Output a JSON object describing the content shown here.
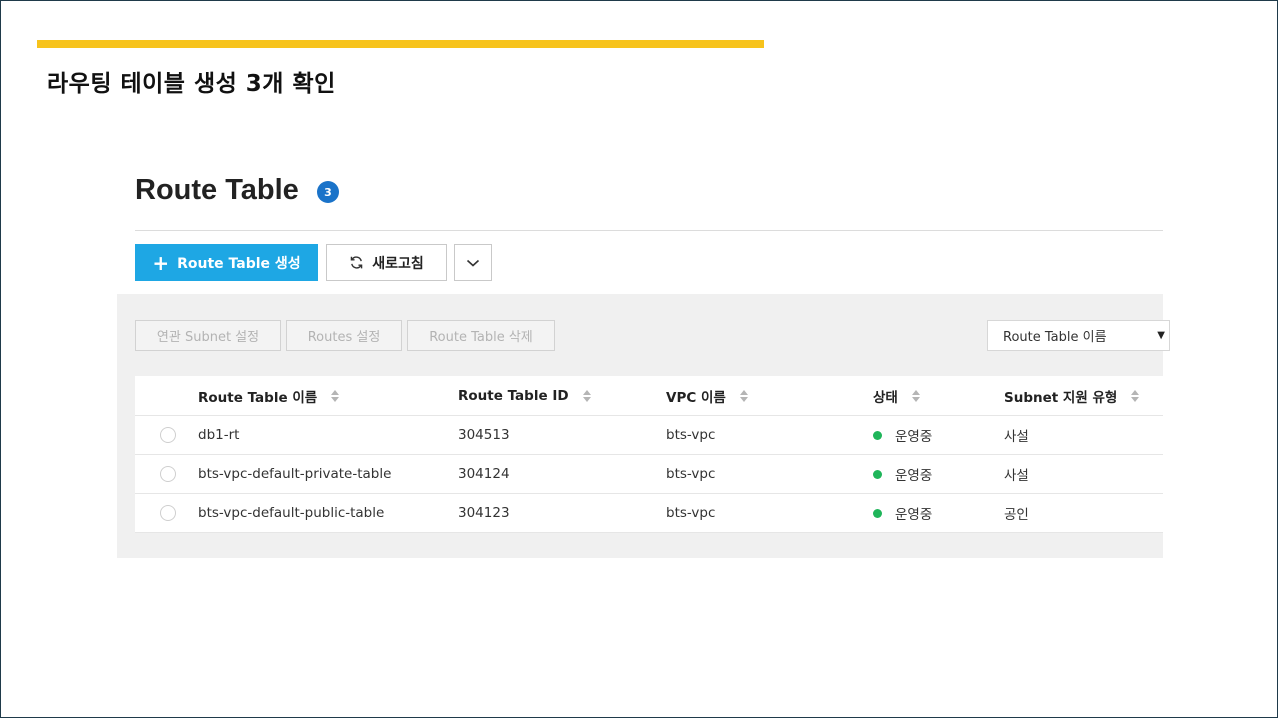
{
  "slide": {
    "title": "라우팅 테이블 생성 3개 확인",
    "accent_color": "#f7c31c"
  },
  "page": {
    "title": "Route Table",
    "count": "3"
  },
  "toolbar": {
    "create_label": "Route Table 생성",
    "refresh_label": "새로고침",
    "more_icon": "chevron-down-icon"
  },
  "actions": {
    "subnet_label": "연관 Subnet 설정",
    "routes_label": "Routes 설정",
    "delete_label": "Route Table 삭제"
  },
  "filter": {
    "selected": "Route Table 이름"
  },
  "table": {
    "columns": [
      "Route Table 이름",
      "Route Table ID",
      "VPC 이름",
      "상태",
      "Subnet 지원 유형"
    ],
    "rows": [
      [
        "db1-rt",
        "304513",
        "bts-vpc",
        "운영중",
        "사설"
      ],
      [
        "bts-vpc-default-private-table",
        "304124",
        "bts-vpc",
        "운영중",
        "사설"
      ],
      [
        "bts-vpc-default-public-table",
        "304123",
        "bts-vpc",
        "운영중",
        "공인"
      ]
    ],
    "status_color": "#1fb55a"
  },
  "colors": {
    "primary": "#1ea7e4",
    "badge": "#1a73c9"
  }
}
